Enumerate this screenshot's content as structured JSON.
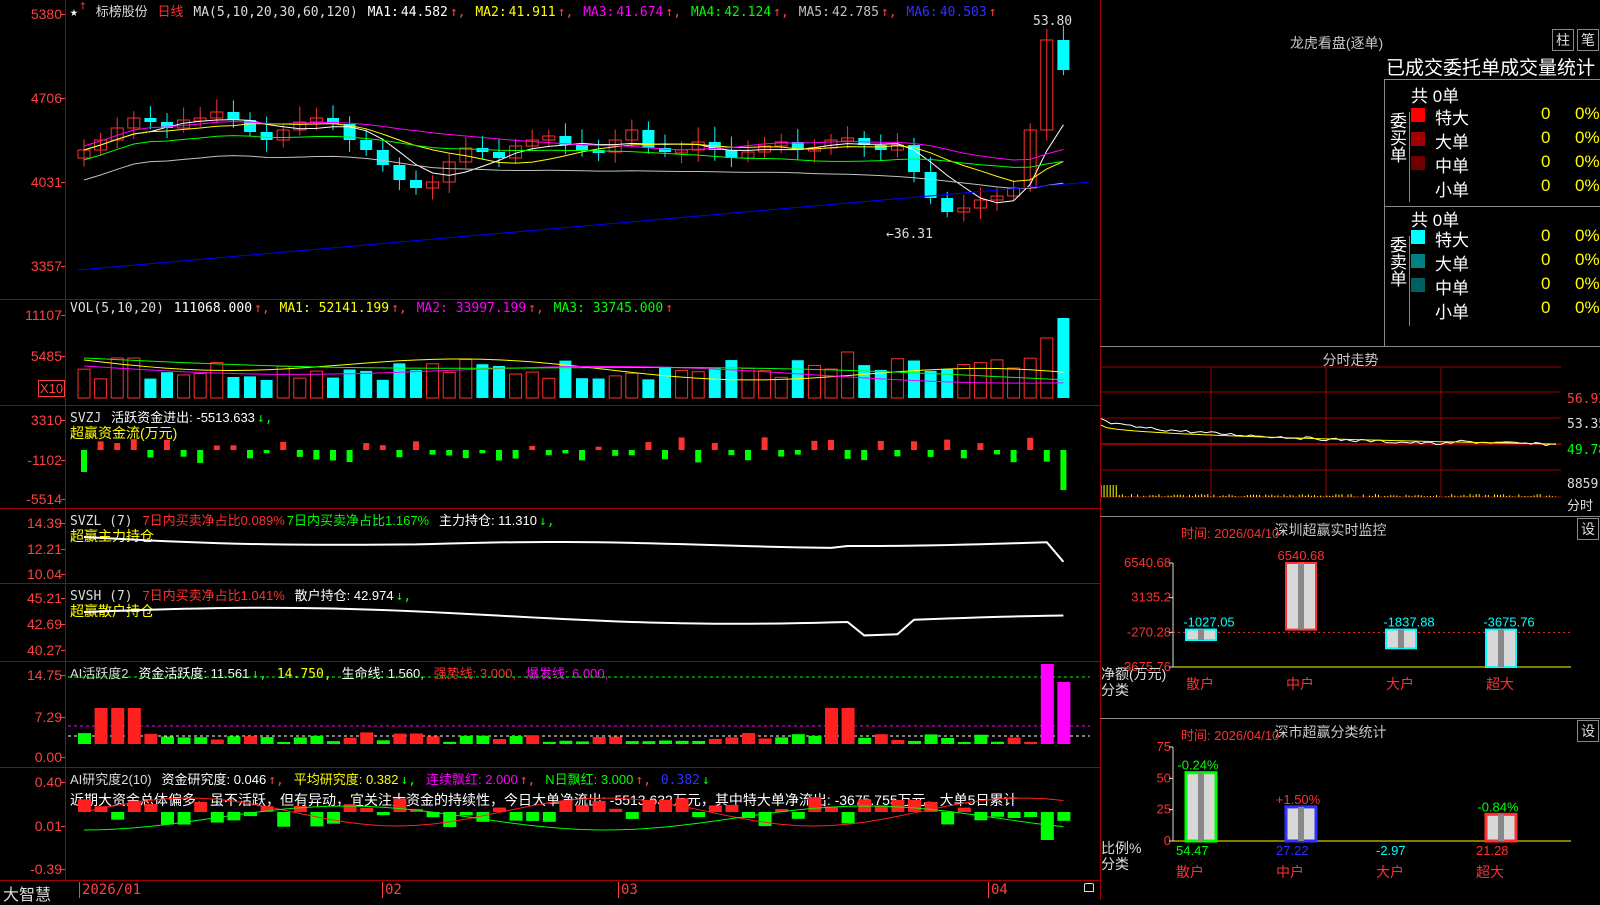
{
  "colors": {
    "up": "#ff3030",
    "down": "#00ffff",
    "frame": "#a00000",
    "ma1": "#ffffff",
    "ma2": "#ffff00",
    "ma3": "#ff00ff",
    "ma4": "#00ff00",
    "ma5": "#c0c0c0",
    "ma6": "#0000ff"
  },
  "chart": {
    "name": "标榜股份",
    "period": "日线",
    "ma_params": "MA(5,10,20,30,60,120)",
    "ma": [
      {
        "label": "MA1:",
        "value": "44.582"
      },
      {
        "label": "MA2:",
        "value": "41.911"
      },
      {
        "label": "MA3:",
        "value": "41.674"
      },
      {
        "label": "MA4:",
        "value": "42.124"
      },
      {
        "label": "MA5:",
        "value": "42.785"
      },
      {
        "label": "MA6:",
        "value": "40.503"
      }
    ],
    "yticks": [
      "5380",
      "4706",
      "4031",
      "3357"
    ],
    "high_label": "53.80",
    "low_label": "36.31"
  },
  "vol": {
    "title": "VOL(5,10,20)",
    "value": "111068.000",
    "ma1": "MA1: 52141.199",
    "ma2": "MA2: 33997.199",
    "ma3": "MA3: 33745.000",
    "yticks": [
      "11107",
      "5485"
    ],
    "unit": "X10"
  },
  "svzj": {
    "title": "SVZJ",
    "text": "活跃资金进出: -5513.633",
    "sub": "超赢资金流(万元)",
    "yticks": [
      "3310",
      "-1102",
      "-5514"
    ]
  },
  "svzl": {
    "title": "SVZL (7)",
    "t1": "7日内买卖净占比0.089%",
    "t2": "7日内买卖净占比1.167%",
    "t3": "主力持仓: 11.310",
    "sub": "超赢主力持仓",
    "yticks": [
      "14.39",
      "12.21",
      "10.04"
    ]
  },
  "svsh": {
    "title": "SVSH (7)",
    "t1": "7日内买卖净占比1.041%",
    "t2": "散户持仓: 42.974",
    "sub": "超赢散户持仓",
    "yticks": [
      "45.21",
      "42.69",
      "40.27"
    ]
  },
  "ai": {
    "title": "AI活跃度2",
    "t1": "资金活跃度: 11.561",
    "t2": "14.750,",
    "t3": "生命线: 1.560,",
    "t4": "强势线: 3.000,",
    "t5": "爆发线: 6.000,",
    "yticks": [
      "14.75",
      "7.29",
      "0.00"
    ]
  },
  "air": {
    "title": "AI研究度2(10)",
    "t1": "资金研究度: 0.046",
    "t2": "平均研究度: 0.382",
    "t3": "连续飘红: 2.000",
    "t4": "N日飘红: 3.000",
    "t5": "0.382",
    "comment": "近期大资金总体偏多，虽不活跃，但有异动，宜关注大资金的持续性，今日大单净流出: -5513.632万元，其中特大单净流出: -3675.755万元，大单5日累计",
    "yticks": [
      "0.40",
      "0.01",
      "-0.39"
    ]
  },
  "xaxis": {
    "labels": [
      "2026/01",
      "02",
      "03",
      "04"
    ],
    "brand": "大智慧"
  },
  "lhb": {
    "title": "龙虎看盘(逐单)",
    "btn1": "柱",
    "btn2": "笔",
    "header": "已成交委托单成交量统计",
    "buy": {
      "label": "委买单",
      "total": "共 0单",
      "rows": [
        {
          "name": "特大",
          "val": "0",
          "pct": "0%",
          "color": "#ff0000"
        },
        {
          "name": "大单",
          "val": "0",
          "pct": "0%",
          "color": "#a00000"
        },
        {
          "name": "中单",
          "val": "0",
          "pct": "0%",
          "color": "#700000"
        },
        {
          "name": "小单",
          "val": "0",
          "pct": "0%",
          "color": "#000000"
        }
      ]
    },
    "sell": {
      "label": "委卖单",
      "total": "共 0单",
      "rows": [
        {
          "name": "特大",
          "val": "0",
          "pct": "0%",
          "color": "#00ffff"
        },
        {
          "name": "大单",
          "val": "0",
          "pct": "0%",
          "color": "#008080"
        },
        {
          "name": "中单",
          "val": "0",
          "pct": "0%",
          "color": "#006060"
        },
        {
          "name": "小单",
          "val": "0",
          "pct": "0%",
          "color": "#000000"
        }
      ]
    }
  },
  "fenshi": {
    "title": "分时走势",
    "yticks": [
      "56.92",
      "53.35",
      "49.78",
      "8859"
    ],
    "unit": "分时"
  },
  "monitor": {
    "title": "深圳超赢实时监控",
    "btn": "设",
    "time": "时间: 2026/04/10",
    "yticks": [
      "6540.68",
      "3135.2",
      "-270.28",
      "-3675.76"
    ],
    "ylabel": "净额(万元)",
    "xlabel": "分类",
    "bars": [
      {
        "cat": "散户",
        "value": -1027.05,
        "label": "-1027.05"
      },
      {
        "cat": "中户",
        "value": 6540.68,
        "label": "6540.68"
      },
      {
        "cat": "大户",
        "value": -1837.88,
        "label": "-1837.88"
      },
      {
        "cat": "超大",
        "value": -3675.76,
        "label": "-3675.76"
      }
    ]
  },
  "classstat": {
    "title": "深市超赢分类统计",
    "btn": "设",
    "time": "时间: 2026/04/10",
    "yticks": [
      "75",
      "50",
      "25",
      "0"
    ],
    "ylabel": "比例%",
    "xlabel": "分类",
    "bars": [
      {
        "cat": "散户",
        "value": 54.47,
        "label": "54.47",
        "change": "-0.24%",
        "color": "#00ff00"
      },
      {
        "cat": "中户",
        "value": 27.22,
        "label": "27.22",
        "change": "+1.50%",
        "color": "#3030ff"
      },
      {
        "cat": "大户",
        "value": -2.97,
        "label": "-2.97",
        "change": "",
        "color": "#00ffff"
      },
      {
        "cat": "超大",
        "value": 21.28,
        "label": "21.28",
        "change": "-0.84%",
        "color": "#ff3030"
      }
    ]
  }
}
